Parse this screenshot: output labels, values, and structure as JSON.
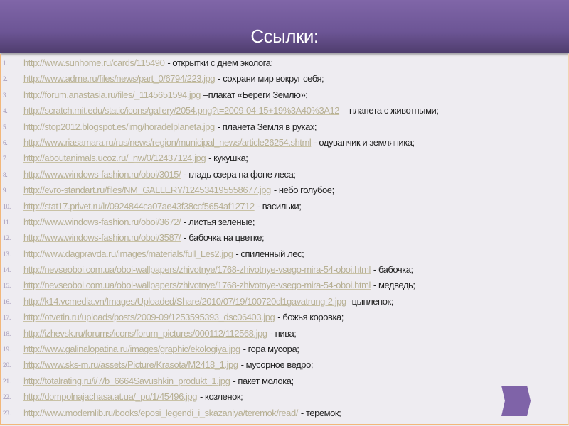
{
  "header": {
    "title": "Ссылки:"
  },
  "links": [
    {
      "num": "1.",
      "url": "http://www.sunhome.ru/cards/115490",
      "desc": "- открытки с днем эколога;"
    },
    {
      "num": "2.",
      "url": "http://www.adme.ru/files/news/part_0/6794/223.jpg",
      "desc": "- сохрани мир вокруг себя;"
    },
    {
      "num": "3.",
      "url": "http://forum.anastasia.ru/files/_1145651594.jpg",
      "desc": "–плакат «Береги Землю»;"
    },
    {
      "num": "4.",
      "url": "http://scratch.mit.edu/static/icons/gallery/2054.png?t=2009-04-15+19%3A40%3A12",
      "desc": "– планета с животными;"
    },
    {
      "num": "5.",
      "url": "http://stop2012.blogspot.es/img/horadelplaneta.jpg",
      "desc": "- планета Земля в руках;"
    },
    {
      "num": "6.",
      "url": "http://www.riasamara.ru/rus/news/region/municipal_news/article26254.shtml",
      "desc": "- одуванчик и земляника;"
    },
    {
      "num": "7.",
      "url": "http://aboutanimals.ucoz.ru/_nw/0/12437124.jpg",
      "desc": "- кукушка;"
    },
    {
      "num": "8.",
      "url": "http://www.windows-fashion.ru/oboi/3015/",
      "desc": "- гладь озера на фоне леса;"
    },
    {
      "num": "9.",
      "url": "http://evro-standart.ru/files/NM_GALLERY/124534195558677.jpg",
      "desc": "- небо голубое;"
    },
    {
      "num": "10.",
      "url": "http://stat17.privet.ru/lr/0924844ca07ae43f38ccf5654af12712",
      "desc": "- васильки;"
    },
    {
      "num": "11.",
      "url": "http://www.windows-fashion.ru/oboi/3672/",
      "desc": "- листья зеленые;"
    },
    {
      "num": "12.",
      "url": "http://www.windows-fashion.ru/oboi/3587/",
      "desc": "- бабочка на цветке;"
    },
    {
      "num": "13.",
      "url": "http://www.dagpravda.ru/images/materials/full_Les2.jpg",
      "desc": "- спиленный лес;"
    },
    {
      "num": "14.",
      "url": "http://nevseoboi.com.ua/oboi-wallpapers/zhivotnye/1768-zhivotnye-vsego-mira-54-oboi.html",
      "desc": "- бабочка;"
    },
    {
      "num": "15.",
      "url": "http://nevseoboi.com.ua/oboi-wallpapers/zhivotnye/1768-zhivotnye-vsego-mira-54-oboi.html",
      "desc": "- медведь;"
    },
    {
      "num": "16.",
      "url": "http://k14.vcmedia.vn/Images/Uploaded/Share/2010/07/19/100720cl1gavatrung-2.jpg",
      "desc": "-цыпленок;"
    },
    {
      "num": "17.",
      "url": "http://otvetin.ru/uploads/posts/2009-09/1253595393_dsc06403.jpg",
      "desc": "- божья коровка;"
    },
    {
      "num": "18.",
      "url": "http://izhevsk.ru/forums/icons/forum_pictures/000112/112568.jpg",
      "desc": "- нива;"
    },
    {
      "num": "19.",
      "url": "http://www.galinalopatina.ru/images/graphic/ekologiya.jpg",
      "desc": "- гора мусора;"
    },
    {
      "num": "20.",
      "url": "http://www.sks-m.ru/assets/Picture/Krasota/M2418_1.jpg",
      "desc": "- мусорное ведро;"
    },
    {
      "num": "21.",
      "url": "http://totalrating.ru/i/7/b_6664Savushkin_produkt_1.jpg",
      "desc": "- пакет молока;"
    },
    {
      "num": "22.",
      "url": "http://dompolnajachasa.at.ua/_pu/1/45496.jpg",
      "desc": "- козленок;"
    },
    {
      "num": "23.",
      "url": "http://www.modernlib.ru/books/eposi_legendi_i_skazaniya/teremok/read/",
      "desc": "- теремок;"
    }
  ],
  "colors": {
    "header": "#7f64a6",
    "link": "#b7b094",
    "border": "#f2b77a",
    "background": "#eeecf1"
  },
  "nav": {
    "next_icon": "chevron-right-icon"
  }
}
